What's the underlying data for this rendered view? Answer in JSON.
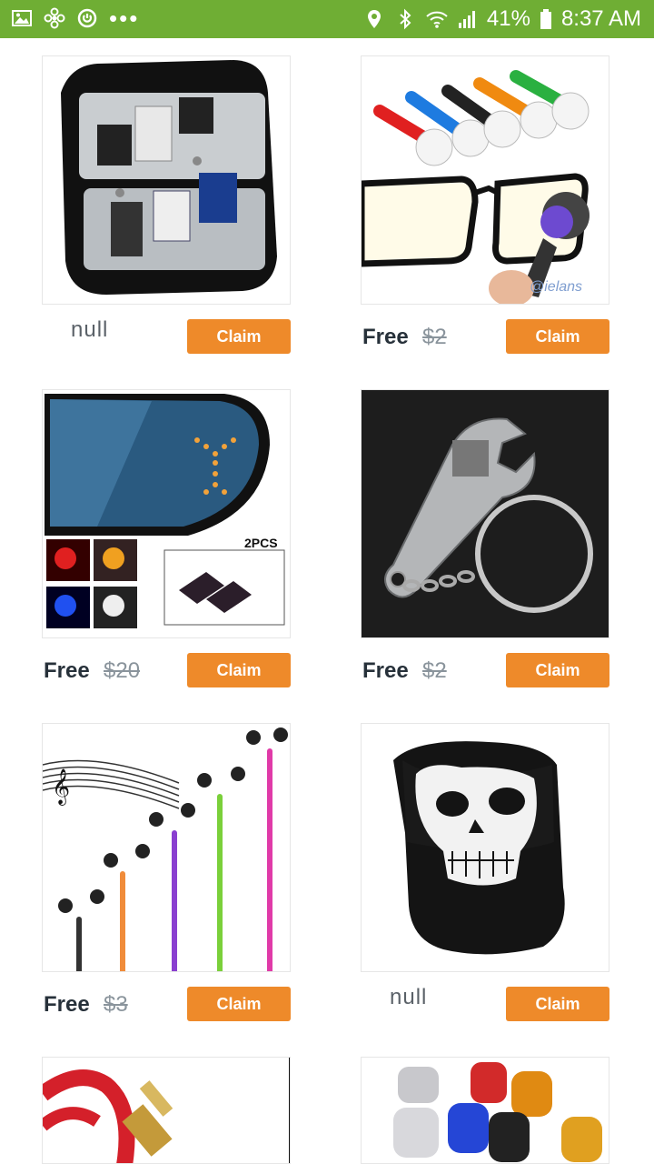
{
  "status_bar": {
    "battery": "41%",
    "time": "8:37 AM",
    "left_icons": [
      "image-icon",
      "fan-icon",
      "sync-icon",
      "more-dots-icon"
    ],
    "right_icons": [
      "location-icon",
      "bluetooth-icon",
      "wifi-icon",
      "signal-icon",
      "battery-icon"
    ],
    "more": "•••",
    "bar_color": "#6fae34"
  },
  "accent_color": "#ee8a2a",
  "products": [
    {
      "image": "memory-card-case",
      "free": "",
      "orig": "",
      "null_label": "null",
      "claim": "Claim"
    },
    {
      "image": "glasses-cleaner-brush",
      "free": "Free",
      "orig": "$2",
      "null_label": "",
      "claim": "Claim",
      "watermark": "@ielans"
    },
    {
      "image": "car-mirror-led-arrow",
      "free": "Free",
      "orig": "$20",
      "null_label": "",
      "claim": "Claim",
      "image_text": "2PCS"
    },
    {
      "image": "wrench-keychain",
      "free": "Free",
      "orig": "$2",
      "null_label": "",
      "claim": "Claim"
    },
    {
      "image": "zipper-earphones",
      "free": "Free",
      "orig": "$3",
      "null_label": "",
      "claim": "Claim"
    },
    {
      "image": "skull-face-mask",
      "free": "",
      "orig": "",
      "null_label": "null",
      "claim": "Claim"
    },
    {
      "image": "audio-cable",
      "claim": ""
    },
    {
      "image": "valve-caps",
      "claim": ""
    }
  ]
}
